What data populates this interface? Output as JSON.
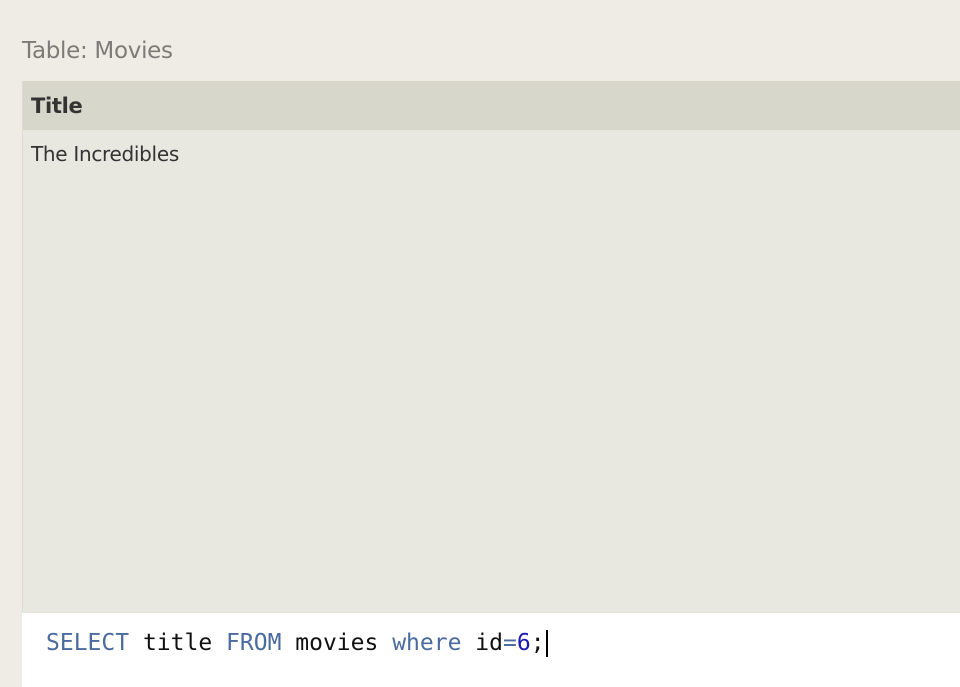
{
  "table": {
    "caption": "Table: Movies",
    "columns": [
      "Title"
    ],
    "rows": [
      [
        "The Incredibles"
      ]
    ]
  },
  "query": {
    "tokens": {
      "select": "SELECT",
      "col": " title ",
      "from": "FROM",
      "table": " movies ",
      "where": "where",
      "field": " id",
      "eq": "=",
      "value": "6",
      "end": ";"
    }
  },
  "colors": {
    "background": "#efece6",
    "panel": "#e8e7e0",
    "header": "#d8d7cb",
    "keyword": "#4b6a9f",
    "number": "#1a1ab3"
  }
}
